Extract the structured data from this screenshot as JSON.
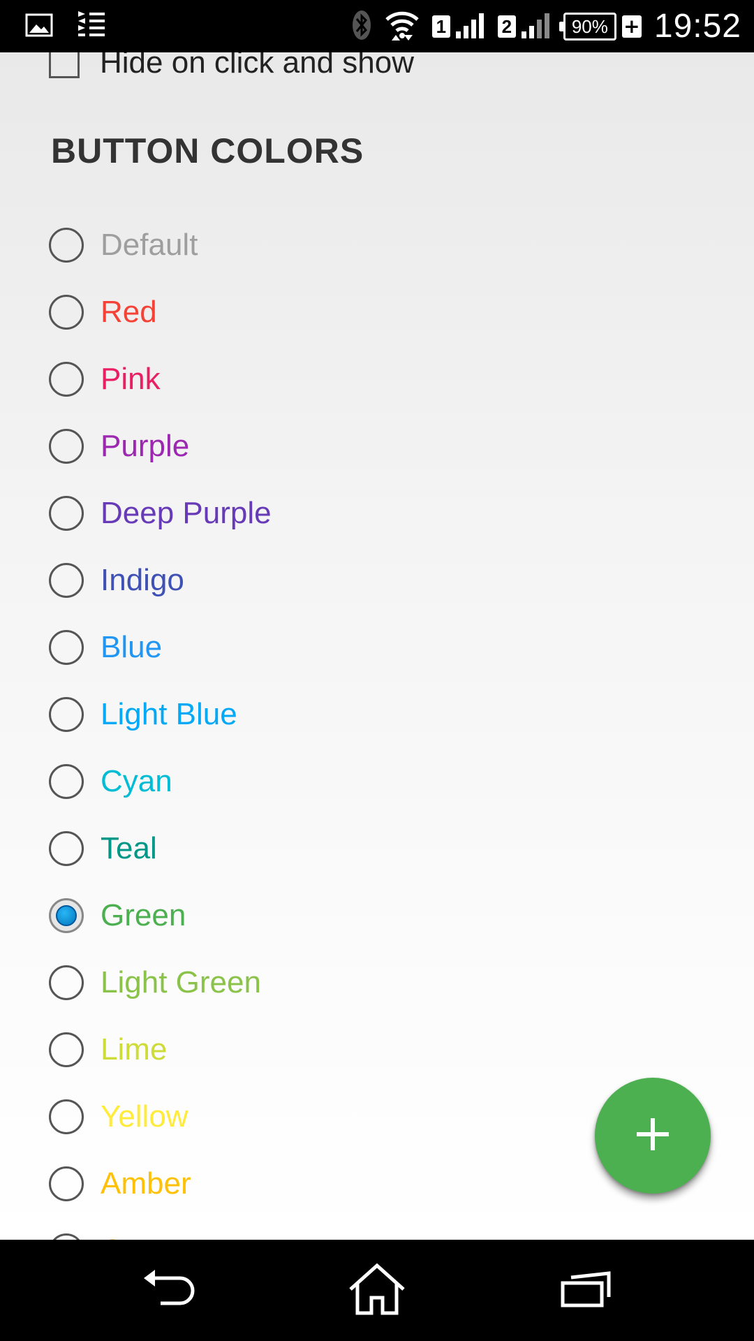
{
  "status_bar": {
    "left_icons": [
      "image-icon",
      "sliders-icon"
    ],
    "right_icons": [
      "bluetooth-icon",
      "wifi-icon",
      "signal-icon",
      "signal-icon",
      "battery-icon",
      "charging-icon"
    ],
    "sim1_label": "1",
    "sim2_label": "2",
    "battery_text": "90%",
    "charge_text": "+",
    "time": "19:52"
  },
  "settings": {
    "checkbox": {
      "label": "Hide on click and show",
      "checked": false
    },
    "section_title": "BUTTON COLORS",
    "selected_color": "Green",
    "colors": [
      {
        "label": "Default",
        "color": "#9e9e9e",
        "selected": false
      },
      {
        "label": "Red",
        "color": "#f44336",
        "selected": false
      },
      {
        "label": "Pink",
        "color": "#e91e63",
        "selected": false
      },
      {
        "label": "Purple",
        "color": "#9c27b0",
        "selected": false
      },
      {
        "label": "Deep Purple",
        "color": "#673ab7",
        "selected": false
      },
      {
        "label": "Indigo",
        "color": "#3f51b5",
        "selected": false
      },
      {
        "label": "Blue",
        "color": "#2196f3",
        "selected": false
      },
      {
        "label": "Light Blue",
        "color": "#03a9f4",
        "selected": false
      },
      {
        "label": "Cyan",
        "color": "#00bcd4",
        "selected": false
      },
      {
        "label": "Teal",
        "color": "#009688",
        "selected": false
      },
      {
        "label": "Green",
        "color": "#4caf50",
        "selected": true
      },
      {
        "label": "Light Green",
        "color": "#8bc34a",
        "selected": false
      },
      {
        "label": "Lime",
        "color": "#cddc39",
        "selected": false
      },
      {
        "label": "Yellow",
        "color": "#ffeb3b",
        "selected": false
      },
      {
        "label": "Amber",
        "color": "#ffc107",
        "selected": false
      },
      {
        "label": "Orange",
        "color": "#ff9800",
        "selected": false
      }
    ]
  },
  "fab": {
    "icon": "plus-icon",
    "color": "#4caf50"
  },
  "nav_bar": {
    "buttons": [
      "back-icon",
      "home-icon",
      "recents-icon"
    ]
  }
}
